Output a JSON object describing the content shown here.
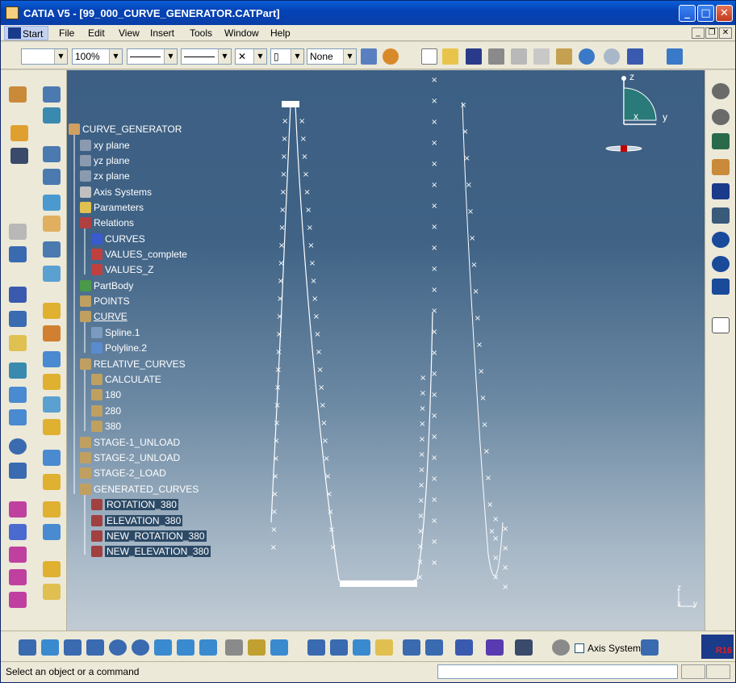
{
  "window": {
    "title": "CATIA V5 - [99_000_CURVE_GENERATOR.CATPart]",
    "min": "_",
    "max": "□",
    "close": "✕"
  },
  "menu": {
    "start": "Start",
    "file": "File",
    "edit": "Edit",
    "view": "View",
    "insert": "Insert",
    "tools": "Tools",
    "window": "Window",
    "help": "Help"
  },
  "toolbar": {
    "zoom": "100%",
    "layer": "None"
  },
  "tree": [
    {
      "label": "CURVE_GENERATOR",
      "icon": "part-icon"
    },
    {
      "label": "xy plane",
      "icon": "plane-icon"
    },
    {
      "label": "yz plane",
      "icon": "plane-icon"
    },
    {
      "label": "zx plane",
      "icon": "plane-icon"
    },
    {
      "label": "Axis Systems",
      "icon": "axis-icon"
    },
    {
      "label": "Parameters",
      "icon": "parameters-icon"
    },
    {
      "label": "Relations",
      "icon": "relations-icon"
    },
    {
      "label": "CURVES",
      "icon": "table-icon"
    },
    {
      "label": "VALUES_complete",
      "icon": "rule-icon"
    },
    {
      "label": "VALUES_Z",
      "icon": "rule-icon"
    },
    {
      "label": "PartBody",
      "icon": "body-icon"
    },
    {
      "label": "POINTS",
      "icon": "geoset-icon"
    },
    {
      "label": "CURVE",
      "icon": "geoset-icon"
    },
    {
      "label": "Spline.1",
      "icon": "spline-icon"
    },
    {
      "label": "Polyline.2",
      "icon": "polyline-icon"
    },
    {
      "label": "RELATIVE_CURVES",
      "icon": "geoset-icon"
    },
    {
      "label": "CALCULATE",
      "icon": "geoset-icon"
    },
    {
      "label": "180",
      "icon": "geoset-icon"
    },
    {
      "label": "280",
      "icon": "geoset-icon"
    },
    {
      "label": "380",
      "icon": "geoset-icon"
    },
    {
      "label": "STAGE-1_UNLOAD",
      "icon": "geoset-icon"
    },
    {
      "label": "STAGE-2_UNLOAD",
      "icon": "geoset-icon"
    },
    {
      "label": "STAGE-2_LOAD",
      "icon": "geoset-icon"
    },
    {
      "label": "GENERATED_CURVES",
      "icon": "geoset-icon"
    },
    {
      "label": "ROTATION_380",
      "icon": "curve-icon"
    },
    {
      "label": "ELEVATION_380",
      "icon": "curve-icon"
    },
    {
      "label": "NEW_ROTATION_380",
      "icon": "curve-icon"
    },
    {
      "label": "NEW_ELEVATION_380",
      "icon": "curve-icon"
    }
  ],
  "compass": {
    "z": "z",
    "x": "x",
    "y": "y"
  },
  "mini_axis": {
    "z": "z",
    "x": "x",
    "y": "y"
  },
  "bottom": {
    "axis_system": "Axis System",
    "logo": "R16"
  },
  "status": {
    "message": "Select an object or a command"
  },
  "colors": {
    "title": "#0a4fc4",
    "viewport_top": "#3c5f83",
    "viewport_bottom": "#c1cbd4"
  }
}
